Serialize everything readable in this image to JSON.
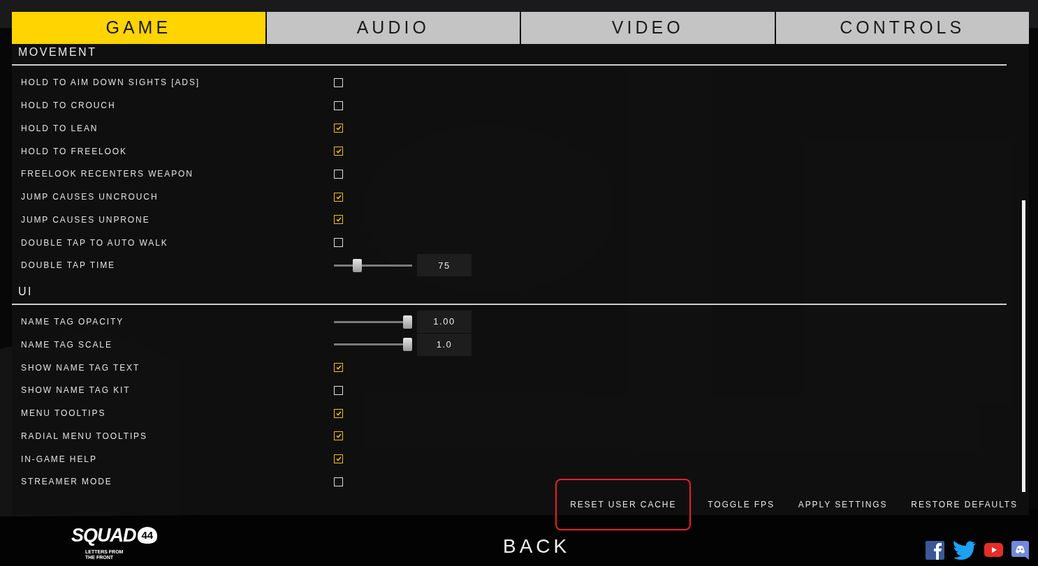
{
  "tabs": [
    {
      "label": "GAME",
      "selected": true
    },
    {
      "label": "AUDIO",
      "selected": false
    },
    {
      "label": "VIDEO",
      "selected": false
    },
    {
      "label": "CONTROLS",
      "selected": false
    }
  ],
  "sections": [
    {
      "title": "MOVEMENT",
      "settings": [
        {
          "kind": "checkbox",
          "label": "HOLD TO AIM DOWN SIGHTS [ADS]",
          "checked": false
        },
        {
          "kind": "checkbox",
          "label": "HOLD TO CROUCH",
          "checked": false
        },
        {
          "kind": "checkbox",
          "label": "HOLD TO LEAN",
          "checked": true
        },
        {
          "kind": "checkbox",
          "label": "HOLD TO FREELOOK",
          "checked": true
        },
        {
          "kind": "checkbox",
          "label": "FREELOOK RECENTERS WEAPON",
          "checked": false
        },
        {
          "kind": "checkbox",
          "label": "JUMP CAUSES UNCROUCH",
          "checked": true
        },
        {
          "kind": "checkbox",
          "label": "JUMP CAUSES UNPRONE",
          "checked": true
        },
        {
          "kind": "checkbox",
          "label": "DOUBLE TAP TO AUTO WALK",
          "checked": false
        },
        {
          "kind": "slider",
          "label": "DOUBLE TAP TIME",
          "level": 0.27,
          "reading": "75"
        }
      ]
    },
    {
      "title": "UI",
      "settings": [
        {
          "kind": "slider",
          "label": "NAME TAG OPACITY",
          "level": 1,
          "reading": "1.00"
        },
        {
          "kind": "slider",
          "label": "NAME TAG SCALE",
          "level": 1,
          "reading": "1.0"
        },
        {
          "kind": "checkbox",
          "label": "SHOW NAME TAG TEXT",
          "checked": true
        },
        {
          "kind": "checkbox",
          "label": "SHOW NAME TAG KIT",
          "checked": false
        },
        {
          "kind": "checkbox",
          "label": "MENU TOOLTIPS",
          "checked": true
        },
        {
          "kind": "checkbox",
          "label": "RADIAL MENU TOOLTIPS",
          "checked": true
        },
        {
          "kind": "checkbox",
          "label": "IN-GAME HELP",
          "checked": true
        },
        {
          "kind": "checkbox",
          "label": "STREAMER MODE",
          "checked": false
        }
      ]
    }
  ],
  "actions": [
    {
      "label": "RESET USER CACHE",
      "highlighted": true
    },
    {
      "label": "TOGGLE FPS",
      "highlighted": false
    },
    {
      "label": "APPLY SETTINGS",
      "highlighted": false
    },
    {
      "label": "RESTORE DEFAULTS",
      "highlighted": false
    }
  ],
  "logo": {
    "title": "SQUAD",
    "number": "44",
    "tagline": [
      "LETTERS FROM",
      "THE FRONT"
    ]
  },
  "back": "BACK"
}
